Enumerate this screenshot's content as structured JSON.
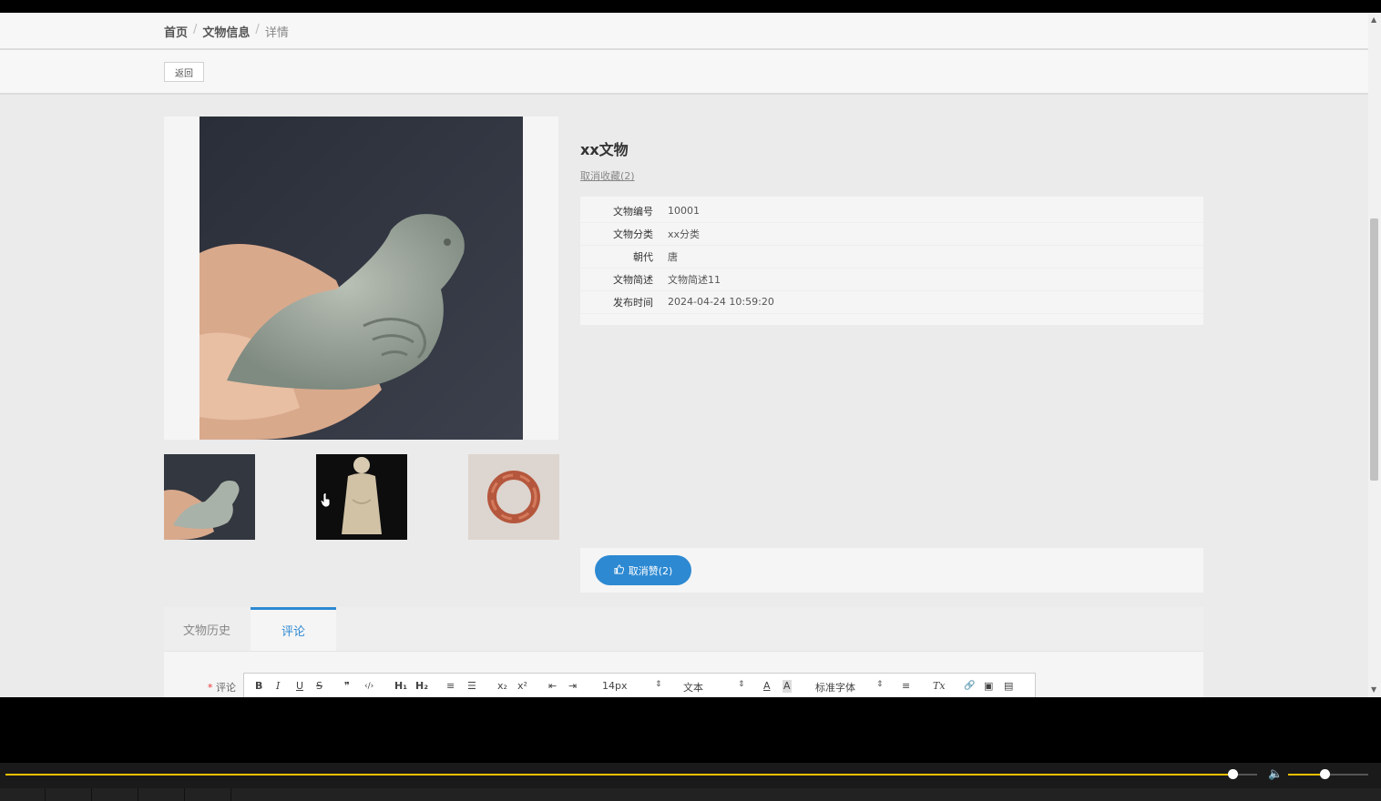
{
  "breadcrumb": {
    "home": "首页",
    "section": "文物信息",
    "current": "详情",
    "separator": "/"
  },
  "toolbar": {
    "back_label": "返回"
  },
  "artifact": {
    "title": "xx文物",
    "favorite_link": "取消收藏(2)",
    "fields": [
      {
        "label": "文物编号",
        "value": "10001"
      },
      {
        "label": "文物分类",
        "value": "xx分类"
      },
      {
        "label": "朝代",
        "value": "唐"
      },
      {
        "label": "文物简述",
        "value": "文物简述11"
      },
      {
        "label": "发布时间",
        "value": "2024-04-24 10:59:20"
      }
    ],
    "like_button": "取消赞(2)"
  },
  "gallery": {
    "thumbnails": [
      "jade-bird-thumbnail",
      "jade-figure-thumbnail",
      "agate-ring-thumbnail"
    ]
  },
  "tabs": [
    {
      "label": "文物历史",
      "active": false
    },
    {
      "label": "评论",
      "active": true
    }
  ],
  "comment": {
    "required_mark": "*",
    "label": "评论",
    "toolbar": {
      "bold": "B",
      "italic": "I",
      "underline": "U",
      "strike": "S",
      "quote": "❞",
      "code": "‹/›",
      "h1": "H₁",
      "h2": "H₂",
      "ordered_list": "≡",
      "bullet_list": "☰",
      "subscript": "x₂",
      "superscript": "x²",
      "outdent": "⇤",
      "indent": "⇥",
      "font_size": "14px",
      "text_type": "文本",
      "font_color": "A",
      "background_color": "A",
      "font_family": "标准字体",
      "align": "≡",
      "clear_format": "Tx",
      "link": "🔗",
      "image": "▣",
      "video": "▤"
    }
  },
  "player": {
    "progress": 0.98,
    "volume": 0.45,
    "accent_color": "#f0c000"
  }
}
